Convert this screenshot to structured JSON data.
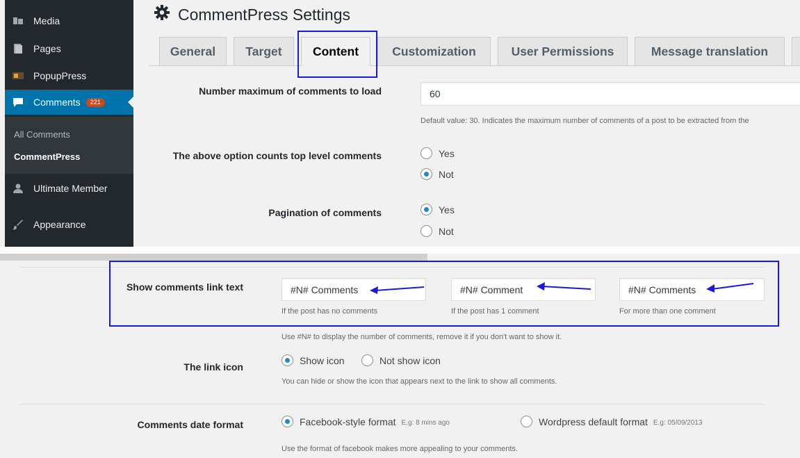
{
  "sidebar": {
    "items": [
      {
        "label": "Media",
        "icon": "media-icon"
      },
      {
        "label": "Pages",
        "icon": "pages-icon"
      },
      {
        "label": "PopupPress",
        "icon": "popuppress-icon"
      },
      {
        "label": "Comments",
        "icon": "comments-icon",
        "badge": "221"
      },
      {
        "label": "Ultimate Member",
        "icon": "user-icon"
      },
      {
        "label": "Appearance",
        "icon": "appearance-icon"
      }
    ],
    "submenu": [
      "All Comments",
      "CommentPress"
    ]
  },
  "header": {
    "title": "CommentPress Settings",
    "icon": "gear-icon"
  },
  "tabs": [
    "General",
    "Target",
    "Content",
    "Customization",
    "User Permissions",
    "Message translation"
  ],
  "settings": {
    "max_comments": {
      "label": "Number maximum of comments to load",
      "value": "60",
      "description": "Default value: 30. Indicates the maximum number of comments of a post to be extracted from the"
    },
    "top_level": {
      "label": "The above option counts top level comments",
      "options": [
        "Yes",
        "Not"
      ],
      "selected": "Not"
    },
    "pagination": {
      "label": "Pagination of comments",
      "options": [
        "Yes",
        "Not"
      ],
      "selected": "Yes"
    },
    "link_text": {
      "label": "Show comments link text",
      "fields": [
        {
          "value": "#N# Comments",
          "hint": "If the post has no comments"
        },
        {
          "value": "#N# Comment",
          "hint": "If the post has 1 comment"
        },
        {
          "value": "#N# Comments",
          "hint": "For more than one comment"
        }
      ],
      "description": "Use #N# to display the number of comments, remove it if you don't want to show it."
    },
    "link_icon": {
      "label": "The link icon",
      "options": [
        "Show icon",
        "Not show icon"
      ],
      "selected": "Show icon",
      "description": "You can hide or show the icon that appears next to the link to show all comments."
    },
    "date_format": {
      "label": "Comments date format",
      "options": [
        {
          "label": "Facebook-style format",
          "example": "E.g: 8 mins ago"
        },
        {
          "label": "Wordpress default format",
          "example": "E.g: 05/09/2013"
        }
      ],
      "selected": "Facebook-style format",
      "description": "Use the format of facebook makes more appealing to your comments."
    }
  },
  "colors": {
    "sidebar_bg": "#23282d",
    "active_menu": "#0073aa",
    "highlight": "#1a1adb",
    "badge": "#ca4a1f",
    "radio_dot": "#1e8cbe"
  }
}
